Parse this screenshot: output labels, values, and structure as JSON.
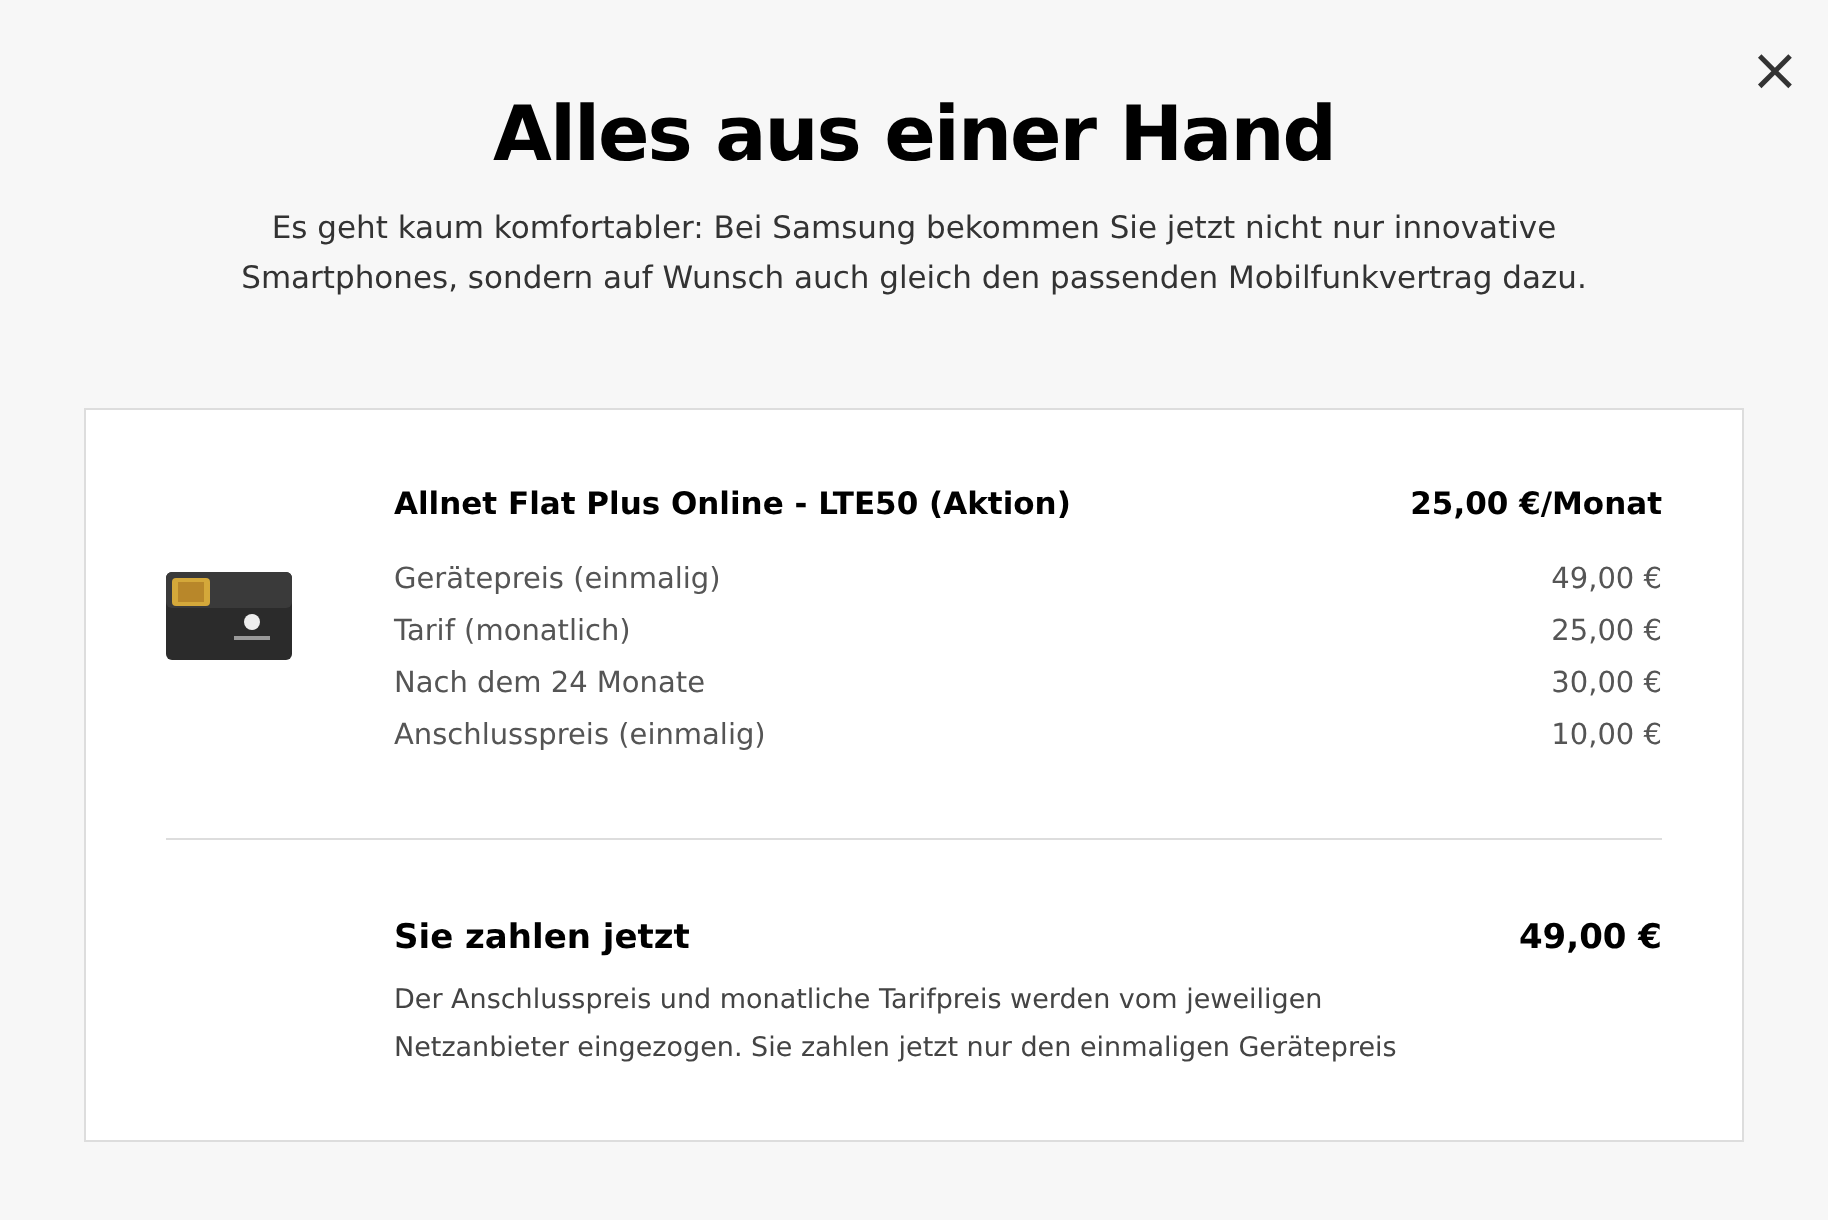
{
  "close_button": {
    "label": "×"
  },
  "title": "Alles aus einer Hand",
  "intro": "Es geht kaum komfortabler: Bei Samsung bekommen Sie jetzt nicht nur innovative Smartphones, sondern auf Wunsch auch gleich den passenden Mobilfunkvertrag dazu.",
  "plan": {
    "name": "Allnet Flat Plus Online - LTE50 (Aktion)",
    "price": "25,00 €/Monat",
    "items": [
      {
        "label": "Gerätepreis (einmalig)",
        "value": "49,00 €"
      },
      {
        "label": "Tarif (monatlich)",
        "value": "25,00 €"
      },
      {
        "label": "Nach dem 24 Monate",
        "value": "30,00 €"
      },
      {
        "label": "Anschlusspreis (einmalig)",
        "value": "10,00 €"
      }
    ]
  },
  "total": {
    "label": "Sie zahlen jetzt",
    "value": "49,00 €",
    "note": "Der Anschlusspreis und monatliche Tarifpreis werden vom jeweiligen Netzanbieter eingezogen. Sie zahlen jetzt nur den einmaligen Gerätepreis"
  }
}
